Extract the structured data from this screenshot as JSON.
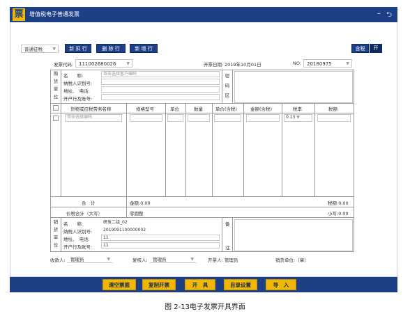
{
  "app": {
    "logo": "票",
    "title": "增值税电子普通发票",
    "minimize": "–",
    "back": "⮌"
  },
  "toolbar": {
    "type_select": "普通征税",
    "btn_copy_row": "新 扣 行",
    "btn_delete_row": "删 除 行",
    "btn_add_row": "新 增 行",
    "tax_incl_label": "含税",
    "tax_incl_switch": "开"
  },
  "header": {
    "code_label": "发票代码:",
    "code_value": "111002680026",
    "date_label": "开票日期:",
    "date_value": "2019年10月01日",
    "no_label": "NO:",
    "no_value": "20180975"
  },
  "buyer": {
    "side_label": [
      "购",
      "货",
      "单",
      "位"
    ],
    "name_label": "名　　称:",
    "name_placeholder": "双击选择客户编码",
    "taxid_label": "纳税人识别号:",
    "addr_label": "地址、　电话:",
    "bank_label": "开户行及账号:",
    "code_area_label": [
      "密",
      "码",
      "区"
    ]
  },
  "items": {
    "headers": [
      "货物或应税劳务名称",
      "规格型号",
      "单位",
      "数量",
      "单价(含税)",
      "金额(含税)",
      "税率",
      "税额"
    ],
    "name_placeholder": "双击选择编码",
    "tax_rate": "0.13"
  },
  "totals": {
    "sum_label": "合　计",
    "amount": "金额:0.00",
    "tax": "税额:0.00",
    "grand_label": "价税合计（大写）",
    "grand_cn": "零圆整",
    "grand_small": "小写:0.00"
  },
  "seller": {
    "side_label": [
      "销",
      "货",
      "单",
      "位"
    ],
    "name_label": "名　　称:",
    "name_value": "研发二组_02",
    "taxid_label": "纳税人识别号:",
    "taxid_value": "2019091100000002",
    "addr_label": "地址、　电话:",
    "addr_value": "11",
    "bank_label": "开户行及账号:",
    "bank_value": "11",
    "remark_label": [
      "备",
      "注"
    ]
  },
  "signers": {
    "payee_label": "收款人:",
    "payee_value": "管理员",
    "checker_label": "复核人:",
    "checker_value": "管理员",
    "drawer_label": "开票人:",
    "drawer_value": "管理员",
    "seller_unit_label": "销货单位:（章）"
  },
  "footer": {
    "clear": "清空票面",
    "copy": "复制开票",
    "issue": "开　具",
    "catalog": "目录设置",
    "import": "导　入"
  },
  "caption": "图 2-13电子发票开具界面"
}
